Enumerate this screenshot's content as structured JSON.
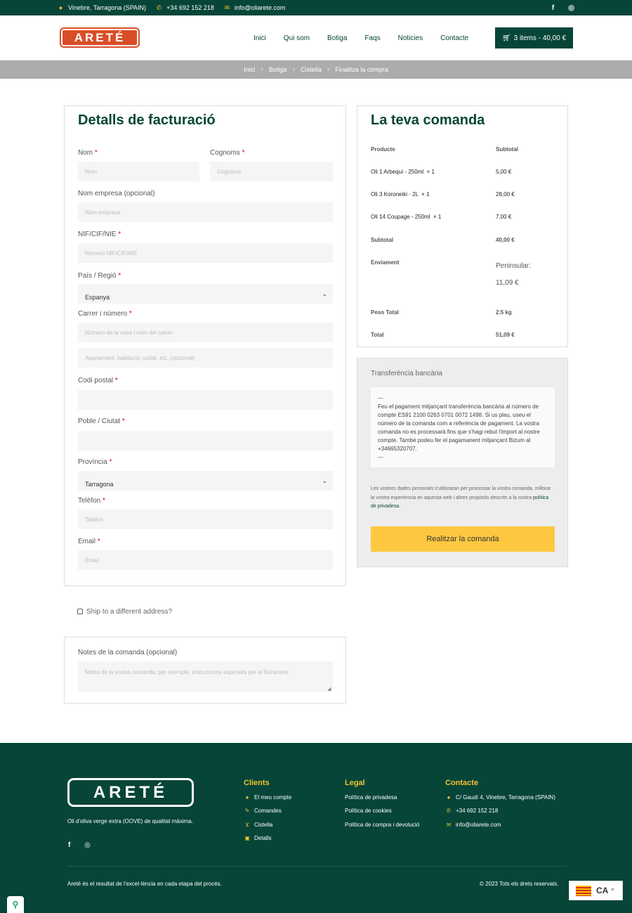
{
  "topbar": {
    "address": "Vinebre, Tarragona (SPAIN)",
    "phone": "+34 692 152 218",
    "email": "info@oliarete.com",
    "facebook": "f",
    "instagram": "◎"
  },
  "header": {
    "logo": "ARETÉ",
    "nav": [
      "Inici",
      "Qui som",
      "Botiga",
      "Faqs",
      "Noticies",
      "Contacte"
    ],
    "cart": "3 items - 40,00 €"
  },
  "breadcrumb": [
    "Inici",
    "Botiga",
    "Cistella",
    "Finalitza la compra"
  ],
  "billing": {
    "title": "Detalls de facturació",
    "req": "*",
    "nom_label": "Nom",
    "nom_ph": "Nom",
    "cognoms_label": "Cognoms",
    "cognoms_ph": "Cognoms",
    "empresa_label": "Nom empresa (opcional)",
    "empresa_ph": "Nom empresa",
    "nif_label": "NIF/CIF/NIE",
    "nif_ph": "Número NIF/CIF/NIE",
    "pais_label": "País / Regió",
    "pais_value": "Espanya",
    "carrer_label": "Carrer i número",
    "carrer_ph": "Número de la casa i nom del carrer",
    "carrer2_ph": "Apartament, habitació, unitat, etc. (opcional)",
    "postal_label": "Codi postal",
    "poble_label": "Poble / Ciutat",
    "provincia_label": "Província",
    "provincia_value": "Tarragona",
    "telefon_label": "Telèfon",
    "telefon_ph": "Telèfon",
    "email_label": "Email",
    "email_ph": "Email"
  },
  "ship": {
    "label": "Ship to a different address?"
  },
  "notes": {
    "label": "Notes de la comanda (opcional)",
    "ph": "Notes de la vostra comanda; per exemple, instruccions especials per al lliurament"
  },
  "order": {
    "title": "La teva comanda",
    "col_product": "Producte",
    "col_subtotal": "Subtotal",
    "items": [
      {
        "name": "Oli 1 Arbequí - 250ml  × 1",
        "price": "5,00 €"
      },
      {
        "name": "Oli 3 Koroneiki - 2L  × 1",
        "price": "28,00 €"
      },
      {
        "name": "Oli 14 Coupage - 250ml  × 1",
        "price": "7,00 €"
      }
    ],
    "subtotal_label": "Subtotal",
    "subtotal": "40,00 €",
    "shipping_label": "Enviament",
    "shipping_name": "Peninsular:",
    "shipping_price": "11,09 €",
    "weight_label": "Peso Total",
    "weight": "2.5 kg",
    "total_label": "Total",
    "total": "51,09 €"
  },
  "payment": {
    "method": "Transferència bancària",
    "desc_l1": "---",
    "desc_body": "Feu el pagament mitjançant transferència bancària al número de compte ES91 2100 0263 0701 0072 1498. Si us plau, useu el número de la comanda com a referència de pagament. La vostra comanda no es processarà fins que s'hagi rebut l'import al nostre compte. També podeu fer el pagamanent mitjançant Bizum al +34665320707.",
    "desc_l3": "---",
    "privacy_pre": "Les vostres dades personals s'utilitzaran per processar la vostra comanda, millorar la vostra experiència en aquesta web i altres propòsits descrits a la nostra ",
    "privacy_link": "política de privadesa",
    "privacy_post": ".",
    "button": "Realitzar la comanda"
  },
  "footer": {
    "logo": "ARETÉ",
    "tagline": "Oli d'oliva verge extra (OOVE) de qualitat màxima.",
    "clients_title": "Clients",
    "clients": [
      "El meu compte",
      "Comandes",
      "Cistella",
      "Detalls"
    ],
    "legal_title": "Legal",
    "legal": [
      "Política de privadesa",
      "Política de cookies",
      "Política de compra i devolució"
    ],
    "contact_title": "Contacte",
    "contact_address": "C/ Gaudí 4, Vinebre, Tarragona (SPAIN)",
    "contact_phone": "+34 692 152 218",
    "contact_email": "info@oliarete.com",
    "bottom_left": "Areté és el resultat de l'excel·lència en cada etapa del procés.",
    "bottom_right": "© 2023 Tots els drets reservats."
  },
  "lang": {
    "code": "CA",
    "arrow": "^"
  },
  "colors": {
    "primary": "#064538",
    "accent": "#f2c230",
    "logo": "#d94e29",
    "button": "#fdc840"
  }
}
